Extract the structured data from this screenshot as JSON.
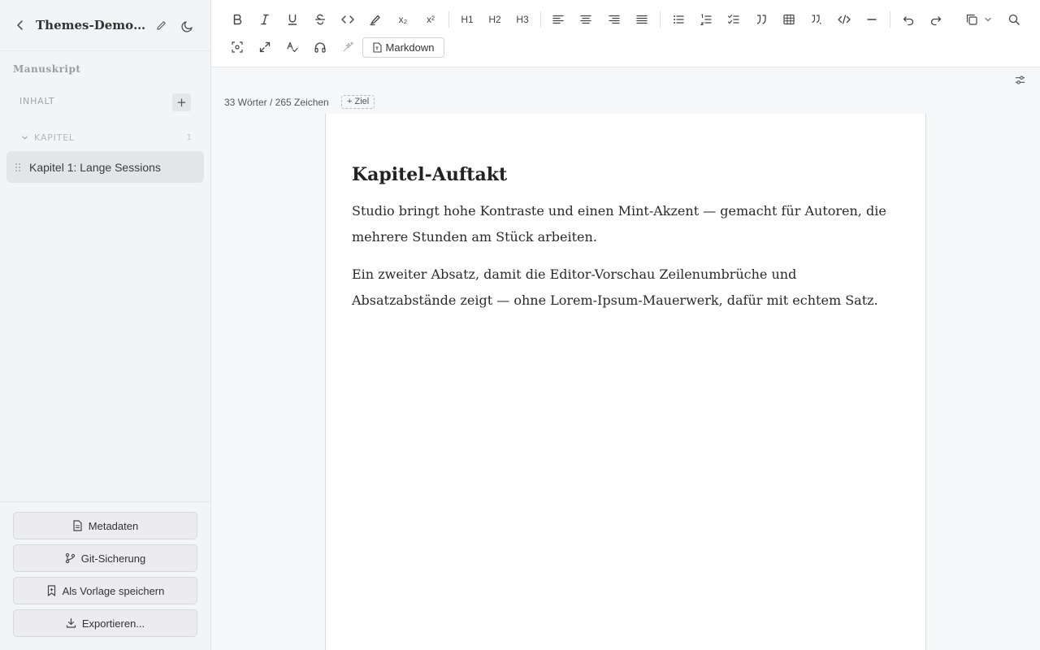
{
  "sidebar": {
    "back_icon": "chevron-left-icon",
    "project_title": "Themes-Demo: Sessions",
    "section_label": "Manuskript",
    "content_label": "INHALT",
    "add_symbol": "+",
    "chapter_group": {
      "label": "KAPITEL",
      "count": "1"
    },
    "items": [
      {
        "label": "Kapitel 1: Lange Sessions"
      }
    ],
    "buttons": {
      "metadata": "Metadaten",
      "git": "Git-Sicherung",
      "template": "Als Vorlage speichern",
      "export": "Exportieren..."
    }
  },
  "toolbar": {
    "markdown_label": "Markdown",
    "subscript": "x₂",
    "superscript": "x²",
    "h1": "H1",
    "h2": "H2",
    "h3": "H3"
  },
  "status": {
    "word_count": "33 Wörter / 265 Zeichen",
    "goal_button": "+ Ziel"
  },
  "document": {
    "heading": "Kapitel-Auftakt",
    "paragraphs": [
      "Studio bringt hohe Kontraste und einen Mint-Akzent — gemacht für Autoren, die mehrere Stunden am Stück arbeiten.",
      "Ein zweiter Absatz, damit die Editor-Vorschau Zeilenumbrüche und Absatzabstände zeigt — ohne Lorem-Ipsum-Mauerwerk, dafür mit echtem Satz."
    ]
  },
  "colors": {
    "sidebar_bg": "#f3f4f5",
    "active_item_bg": "#e3e5e7",
    "page_bg": "#ffffff",
    "canvas_bg": "#f6f7f8"
  }
}
